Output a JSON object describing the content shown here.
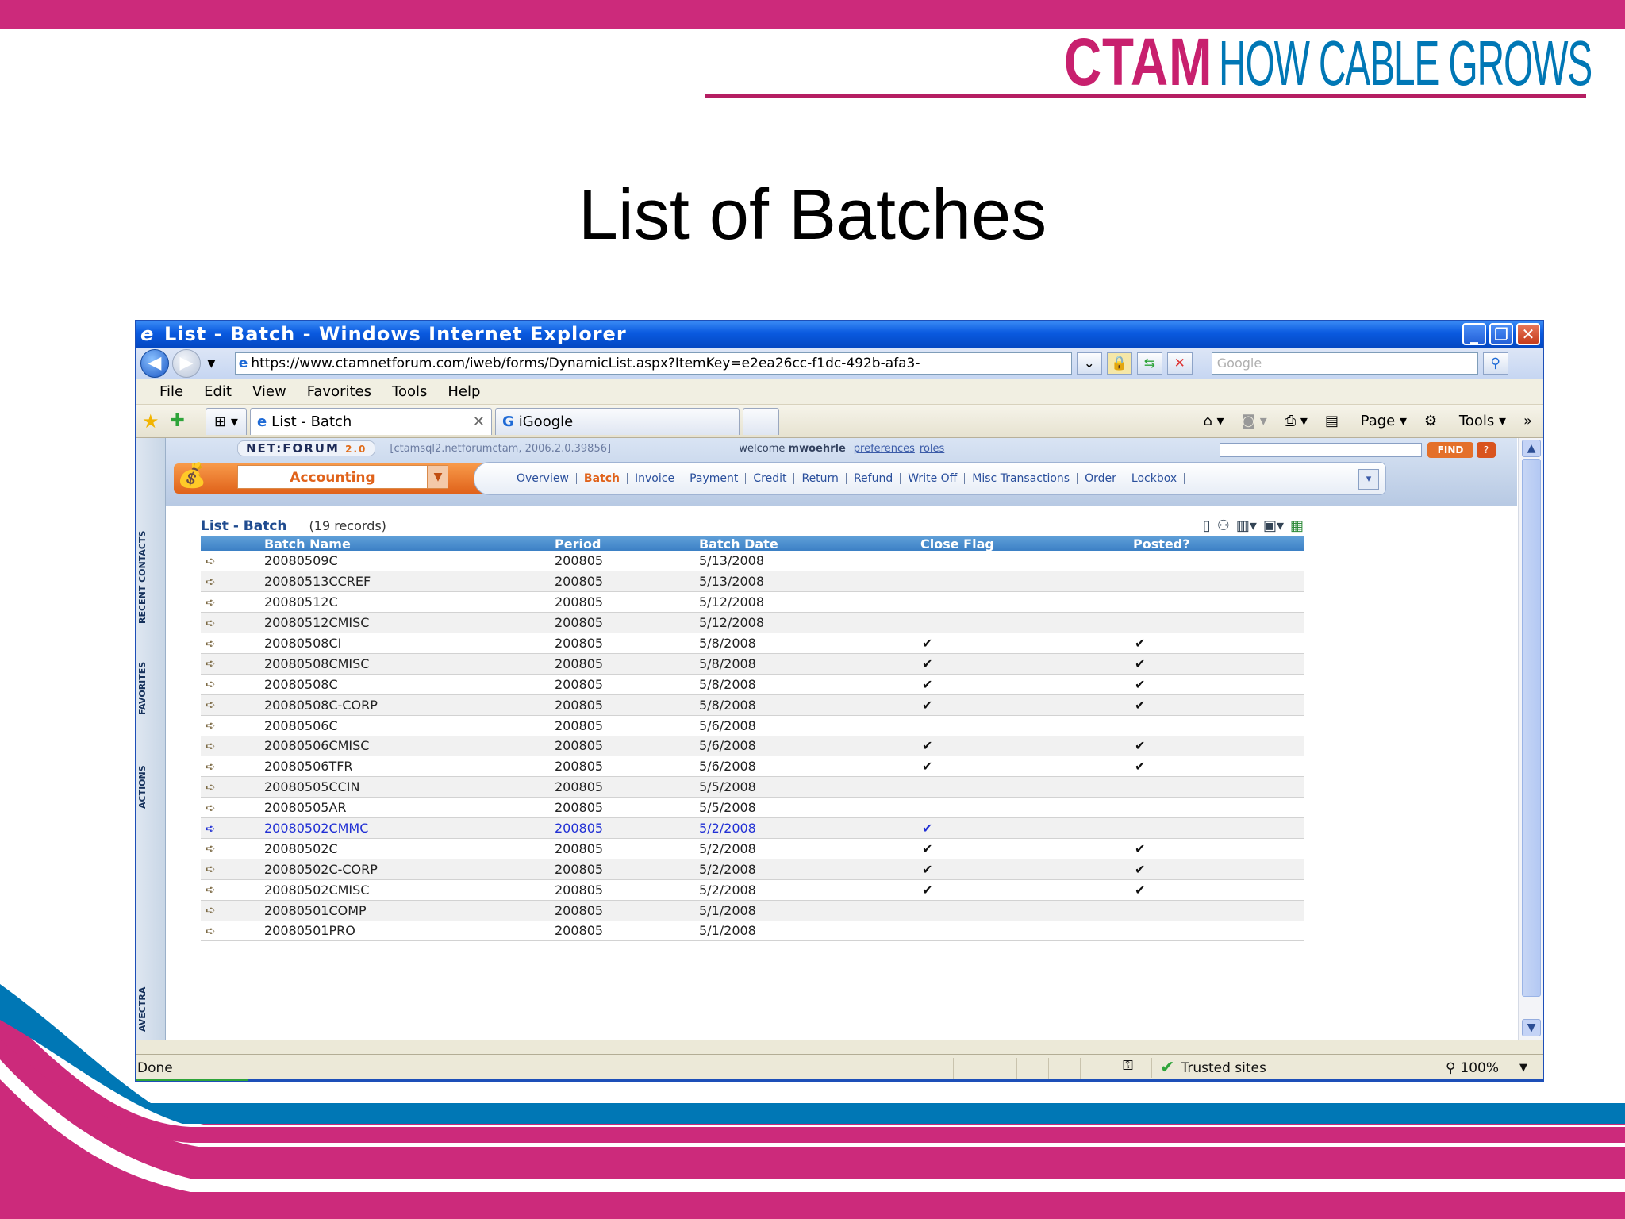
{
  "slide": {
    "brand_ctam": "CTAM",
    "brand_tagline": "HOW CABLE GROWS",
    "title": "List of Batches",
    "colors": {
      "magenta": "#cc2a7b",
      "blue": "#0077b5"
    }
  },
  "browser": {
    "window_title": "List - Batch - Windows Internet Explorer",
    "window_buttons": [
      "_",
      "❐",
      "✕"
    ],
    "url": "https://www.ctamnetforum.com/iweb/forms/DynamicList.aspx?ItemKey=e2ea26cc-f1dc-492b-afa3-",
    "search_placeholder": "Google",
    "menu": [
      "File",
      "Edit",
      "View",
      "Favorites",
      "Tools",
      "Help"
    ],
    "tabs": [
      {
        "label": "List - Batch",
        "active": true
      },
      {
        "label": "iGoogle",
        "active": false
      }
    ],
    "command_bar": {
      "page": "Page",
      "tools": "Tools"
    },
    "status": {
      "text": "Done",
      "zone": "Trusted sites",
      "zoom": "100%"
    }
  },
  "netforum": {
    "logo": "NET:FORUM",
    "version": "2.0",
    "server": "[ctamsql2.netforumctam, 2006.2.0.39856]",
    "welcome": "welcome",
    "user": "mwoehrle",
    "links": [
      "preferences",
      "roles"
    ],
    "find_label": "FIND",
    "help_label": "?",
    "module": "Accounting",
    "nav_tabs": [
      "Overview",
      "Batch",
      "Invoice",
      "Payment",
      "Credit",
      "Return",
      "Refund",
      "Write Off",
      "Misc Transactions",
      "Order",
      "Lockbox"
    ],
    "active_tab": "Batch",
    "rail": [
      "RECENT CONTACTS",
      "FAVORITES",
      "ACTIONS",
      "AVECTRA"
    ]
  },
  "list": {
    "title": "List - Batch",
    "count": "(19 records)",
    "columns": [
      "Batch Name",
      "Period",
      "Batch Date",
      "Close Flag",
      "Posted?"
    ],
    "rows": [
      {
        "name": "20080509C",
        "period": "200805",
        "date": "5/13/2008",
        "close": false,
        "posted": false
      },
      {
        "name": "20080513CCREF",
        "period": "200805",
        "date": "5/13/2008",
        "close": false,
        "posted": false
      },
      {
        "name": "20080512C",
        "period": "200805",
        "date": "5/12/2008",
        "close": false,
        "posted": false
      },
      {
        "name": "20080512CMISC",
        "period": "200805",
        "date": "5/12/2008",
        "close": false,
        "posted": false
      },
      {
        "name": "20080508CI",
        "period": "200805",
        "date": "5/8/2008",
        "close": true,
        "posted": true
      },
      {
        "name": "20080508CMISC",
        "period": "200805",
        "date": "5/8/2008",
        "close": true,
        "posted": true
      },
      {
        "name": "20080508C",
        "period": "200805",
        "date": "5/8/2008",
        "close": true,
        "posted": true
      },
      {
        "name": "20080508C-CORP",
        "period": "200805",
        "date": "5/8/2008",
        "close": true,
        "posted": true
      },
      {
        "name": "20080506C",
        "period": "200805",
        "date": "5/6/2008",
        "close": false,
        "posted": false
      },
      {
        "name": "20080506CMISC",
        "period": "200805",
        "date": "5/6/2008",
        "close": true,
        "posted": true
      },
      {
        "name": "20080506TFR",
        "period": "200805",
        "date": "5/6/2008",
        "close": true,
        "posted": true
      },
      {
        "name": "20080505CCIN",
        "period": "200805",
        "date": "5/5/2008",
        "close": false,
        "posted": false
      },
      {
        "name": "20080505AR",
        "period": "200805",
        "date": "5/5/2008",
        "close": false,
        "posted": false
      },
      {
        "name": "20080502CMMC",
        "period": "200805",
        "date": "5/2/2008",
        "close": true,
        "posted": false,
        "highlighted": true
      },
      {
        "name": "20080502C",
        "period": "200805",
        "date": "5/2/2008",
        "close": true,
        "posted": true
      },
      {
        "name": "20080502C-CORP",
        "period": "200805",
        "date": "5/2/2008",
        "close": true,
        "posted": true
      },
      {
        "name": "20080502CMISC",
        "period": "200805",
        "date": "5/2/2008",
        "close": true,
        "posted": true
      },
      {
        "name": "20080501COMP",
        "period": "200805",
        "date": "5/1/2008",
        "close": false,
        "posted": false
      },
      {
        "name": "20080501PRO",
        "period": "200805",
        "date": "5/1/2008",
        "close": false,
        "posted": false
      }
    ]
  }
}
